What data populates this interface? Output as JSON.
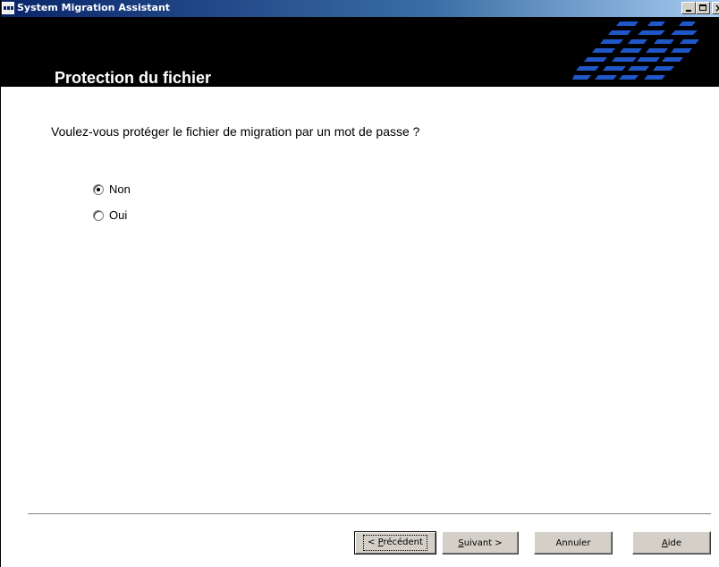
{
  "window": {
    "title": "System Migration Assistant",
    "controls": {
      "minimize": "minimize-icon",
      "maximize": "maximize-icon",
      "close": "close-icon"
    }
  },
  "header": {
    "title": "Protection du fichier",
    "logo": "IBM"
  },
  "main": {
    "question": "Voulez-vous protéger le fichier de migration par un mot de passe ?",
    "options": [
      {
        "label": "Non",
        "selected": true
      },
      {
        "label": "Oui",
        "selected": false
      }
    ]
  },
  "footer": {
    "previous_mnemonic": "P",
    "previous_before": "< ",
    "previous_after": "récédent",
    "next_mnemonic": "S",
    "next_after": "uivant >",
    "cancel_label": "Annuler",
    "help_mnemonic": "A",
    "help_after": "ide"
  },
  "colors": {
    "titlebar_start": "#0a246a",
    "titlebar_end": "#a6caf0",
    "header_bg": "#000000",
    "logo": "#1f57c8",
    "button_face": "#d4d0c8"
  }
}
